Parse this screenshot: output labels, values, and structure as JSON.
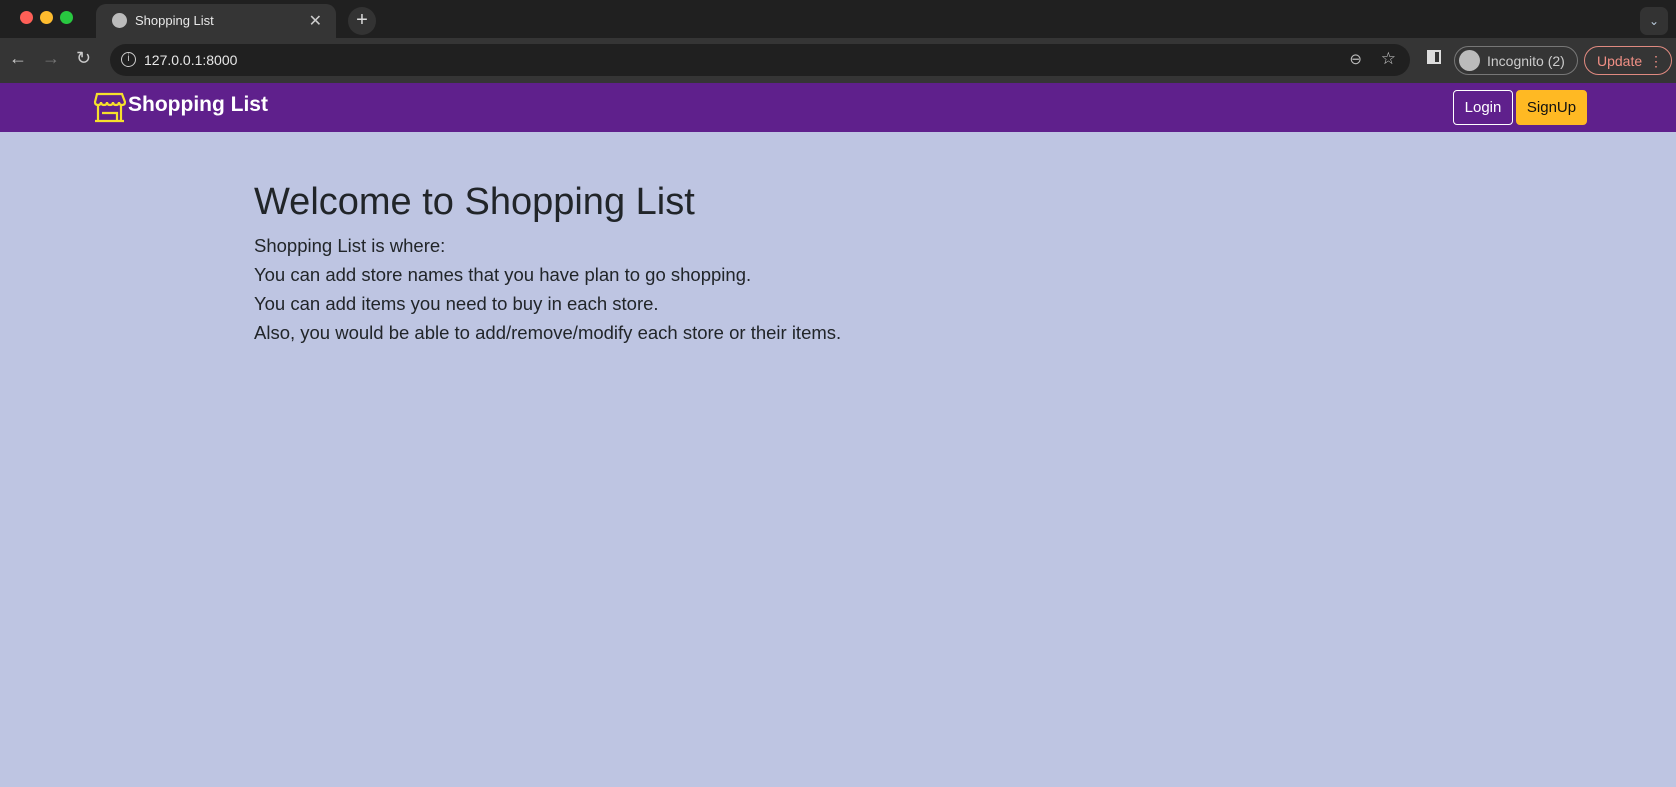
{
  "browser": {
    "tab_title": "Shopping List",
    "url": "127.0.0.1:8000",
    "profile": "Incognito (2)",
    "update_label": "Update"
  },
  "navbar": {
    "brand": "Shopping List",
    "login_label": "Login",
    "signup_label": "SignUp",
    "brand_color": "#5f208c",
    "signup_color": "#ffb923"
  },
  "main": {
    "title": "Welcome to Shopping List",
    "lines": [
      "Shopping List is where:",
      "You can add store names that you have plan to go shopping.",
      "You can add items you need to buy in each store.",
      "Also, you would be able to add/remove/modify each store or their items."
    ]
  }
}
